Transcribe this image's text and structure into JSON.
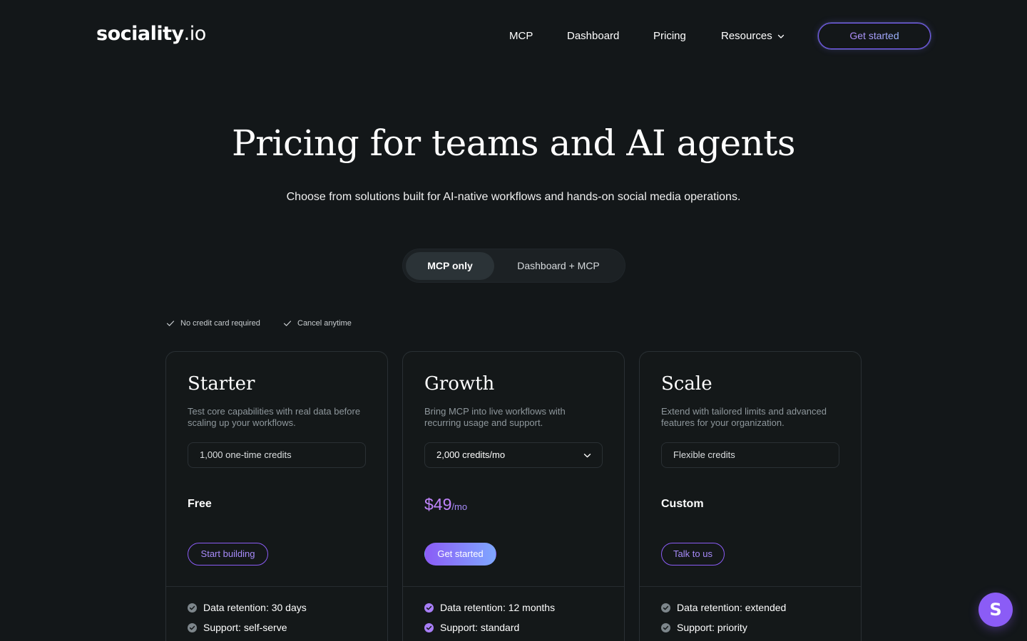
{
  "header": {
    "logo_brand": "sociality",
    "logo_tld": ".io",
    "nav": [
      "MCP",
      "Dashboard",
      "Pricing",
      "Resources"
    ],
    "cta": "Get started"
  },
  "hero": {
    "title": "Pricing for teams and AI agents",
    "subtitle": "Choose from solutions built for AI-native workflows and hands-on social media operations."
  },
  "toggle": {
    "options": [
      "MCP only",
      "Dashboard + MCP"
    ],
    "selected": "MCP only"
  },
  "perks": [
    "No credit card required",
    "Cancel anytime"
  ],
  "plans": [
    {
      "name": "Starter",
      "description": "Test core capabilities with real data before scaling up your workflows.",
      "credits": "1,000 one-time credits",
      "price": "Free",
      "button": "Start building",
      "features": [
        "Data retention: 30 days",
        "Support: self-serve"
      ]
    },
    {
      "name": "Growth",
      "description": "Bring MCP into live workflows with recurring usage and support.",
      "credits": "2,000 credits/mo",
      "price_amount": "$49",
      "price_period": "/mo",
      "button": "Get started",
      "features": [
        "Data retention: 12 months",
        "Support: standard"
      ]
    },
    {
      "name": "Scale",
      "description": "Extend with tailored limits and advanced features for your organization.",
      "credits": "Flexible credits",
      "price": "Custom",
      "button": "Talk to us",
      "features": [
        "Data retention: extended",
        "Support: priority"
      ]
    }
  ],
  "chat": {
    "icon_letter": "S"
  },
  "colors": {
    "background": "#131719",
    "accent": "#8b5cf6",
    "accent_light": "#a78bfa",
    "muted_check": "#7d868b"
  }
}
